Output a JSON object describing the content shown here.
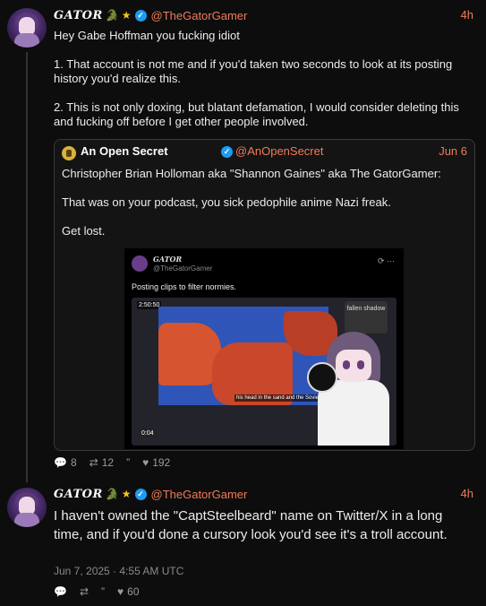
{
  "post1": {
    "author_name": "GATOR",
    "handle": "@TheGatorGamer",
    "time": "4h",
    "lines": [
      "Hey Gabe Hoffman you fucking idiot",
      "1. That account is not me and if you'd taken two seconds to look at its posting history you'd realize this.",
      "2. This is not only doxing, but blatant defamation, I would consider deleting this and fucking off before I get other people involved."
    ],
    "quote": {
      "author_name": "An Open Secret",
      "handle": "@AnOpenSecret",
      "date": "Jun 6",
      "lines": [
        "Christopher Brian Holloman aka \"Shannon Gaines\" aka The GatorGamer:",
        "That was on your podcast, you sick pedophile anime Nazi freak.",
        "Get lost."
      ],
      "media": {
        "author_name": "GATOR",
        "handle": "@TheGatorGamer",
        "text": "Posting clips to filter normies.",
        "video_time": "0:04",
        "timer": "2:50:50",
        "caption": "his head in the sand and the Soviets",
        "logo": "fallen shadow"
      }
    },
    "stats": {
      "replies": "8",
      "reposts": "12",
      "likes": "192"
    }
  },
  "post2": {
    "author_name": "GATOR",
    "handle": "@TheGatorGamer",
    "time": "4h",
    "text": "I haven't owned the \"CaptSteelbeard\" name on Twitter/X in a long time, and if you'd done a cursory look you'd see it's a troll account.",
    "date": "Jun 7, 2025 · 4:55 AM UTC",
    "stats": {
      "likes": "60"
    }
  },
  "icons": [
    "reply-icon",
    "repost-icon",
    "quote-icon",
    "like-icon",
    "verified-icon",
    "crocodile-icon",
    "star-icon"
  ],
  "colors": {
    "accent": "#f07a5a",
    "verified": "#1d9bf0",
    "background": "#0d0d0d"
  }
}
